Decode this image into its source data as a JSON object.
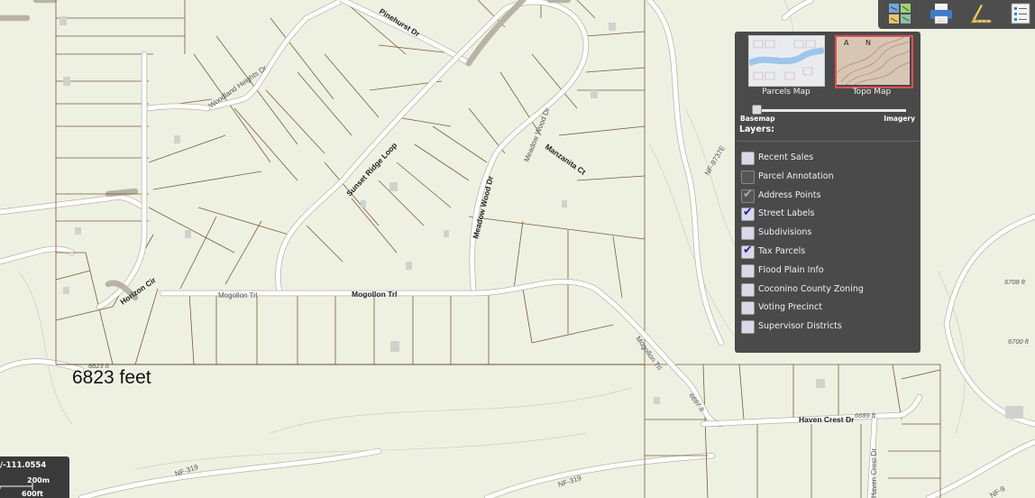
{
  "map": {
    "streets": [
      {
        "id": "pinehurst",
        "label": "Pinehurst Dr"
      },
      {
        "id": "woodland",
        "label": "Woodland Heights Dr"
      },
      {
        "id": "sunset",
        "label": "Sunset Ridge Loop"
      },
      {
        "id": "meadow-wood",
        "label": "Meadow Wood Dr"
      },
      {
        "id": "meadow-wood-2",
        "label": "Meadow Wood Dr"
      },
      {
        "id": "manzanita",
        "label": "Manzanita Ct"
      },
      {
        "id": "horizon",
        "label": "Horizon Cir"
      },
      {
        "id": "mogollon-1",
        "label": "Mogollon Trl"
      },
      {
        "id": "mogollon-2",
        "label": "Mogollon Trl"
      },
      {
        "id": "mogollon-3",
        "label": "Mogollon Trl"
      },
      {
        "id": "haven",
        "label": "Haven Crest Dr"
      },
      {
        "id": "haven-2",
        "label": "Haven Crest Dr"
      },
      {
        "id": "nf9737",
        "label": "NF-9737E"
      },
      {
        "id": "nf319a",
        "label": "NF-319"
      },
      {
        "id": "nf319b",
        "label": "NF-319"
      },
      {
        "id": "nf9",
        "label": "NF-9"
      }
    ],
    "elevations": [
      "6708 ft",
      "6700 ft",
      "6823 ft",
      "6689 ft",
      "6697 ft"
    ],
    "measure_result": "6823 feet"
  },
  "toolbar": {
    "icons": [
      "basemap-grid-icon",
      "print-icon",
      "measure-icon",
      "legend-list-icon"
    ]
  },
  "panel": {
    "basemaps": [
      {
        "label": "Parcels Map",
        "selected": false
      },
      {
        "label": "Topo Map",
        "selected": true
      }
    ],
    "slider": {
      "left_label": "Basemap",
      "right_label": "Imagery",
      "value": 0
    },
    "layers_title": "Layers:",
    "layers": [
      {
        "label": "Recent Sales",
        "checked": false,
        "disabled": false
      },
      {
        "label": "Parcel Annotation",
        "checked": false,
        "disabled": true
      },
      {
        "label": "Address Points",
        "checked": true,
        "disabled": true
      },
      {
        "label": "Street Labels",
        "checked": true,
        "disabled": false
      },
      {
        "label": "Subdivisions",
        "checked": false,
        "disabled": false
      },
      {
        "label": "Tax Parcels",
        "checked": true,
        "disabled": false
      },
      {
        "label": "Flood Plain Info",
        "checked": false,
        "disabled": false
      },
      {
        "label": "Coconino County Zoning",
        "checked": false,
        "disabled": false
      },
      {
        "label": "Voting Precinct",
        "checked": false,
        "disabled": false
      },
      {
        "label": "Supervisor Districts",
        "checked": false,
        "disabled": false
      }
    ]
  },
  "scale": {
    "coords": "/-111.0554",
    "metric": "200m",
    "imperial": "600ft"
  },
  "colors": {
    "panel_bg": "#4a4a4a",
    "map_bg": "#eef1e2",
    "parcel_line": "#7a5a3a",
    "selected_basemap_border": "#e05050"
  }
}
